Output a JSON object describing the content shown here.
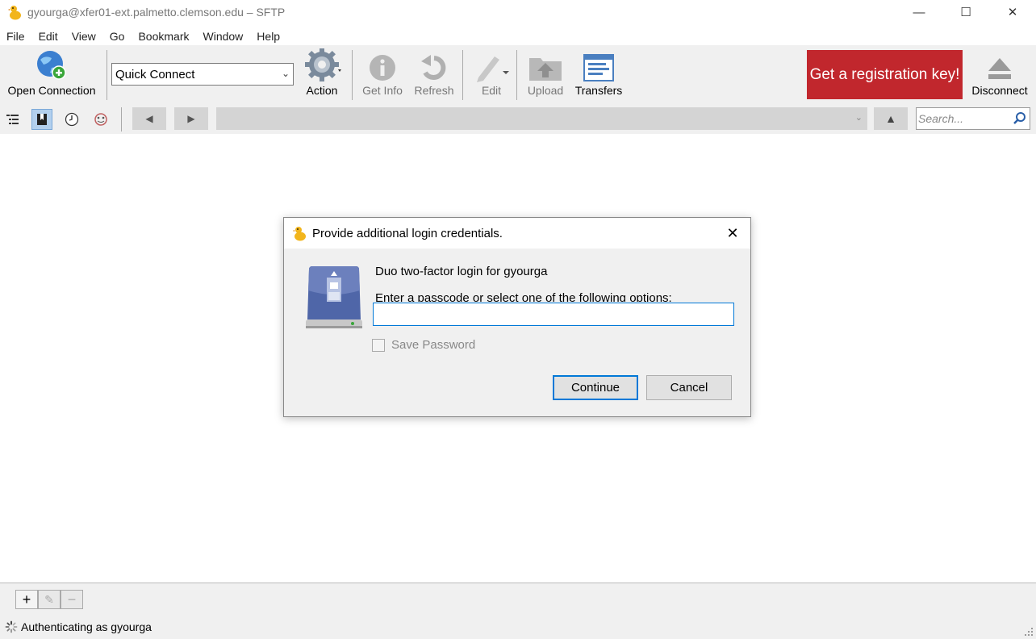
{
  "window": {
    "title": "gyourga@xfer01-ext.palmetto.clemson.edu – SFTP",
    "controls": {
      "minimize": "—",
      "maximize": "☐",
      "close": "✕"
    }
  },
  "menu": [
    "File",
    "Edit",
    "View",
    "Go",
    "Bookmark",
    "Window",
    "Help"
  ],
  "toolbar": {
    "open_connection": "Open Connection",
    "quick_connect": "Quick Connect",
    "action": "Action",
    "get_info": "Get Info",
    "refresh": "Refresh",
    "edit": "Edit",
    "upload": "Upload",
    "transfers": "Transfers",
    "registration": "Get a registration key!",
    "disconnect": "Disconnect"
  },
  "navbar": {
    "back": "◀",
    "forward": "▶",
    "up": "▲",
    "path": "",
    "search_placeholder": "Search..."
  },
  "dialog": {
    "title": "Provide additional login credentials.",
    "heading": "Duo two-factor login for gyourga",
    "message": "Enter a passcode or select one of the following options:",
    "input_value": "",
    "save_password": "Save Password",
    "save_password_checked": false,
    "continue": "Continue",
    "cancel": "Cancel"
  },
  "bottom": {
    "add": "+",
    "edit": "✎",
    "remove": "−",
    "status": "Authenticating as gyourga"
  },
  "colors": {
    "accent": "#0078d7",
    "registration_bg": "#c1272d",
    "toolbar_bg": "#f0f0f0"
  }
}
